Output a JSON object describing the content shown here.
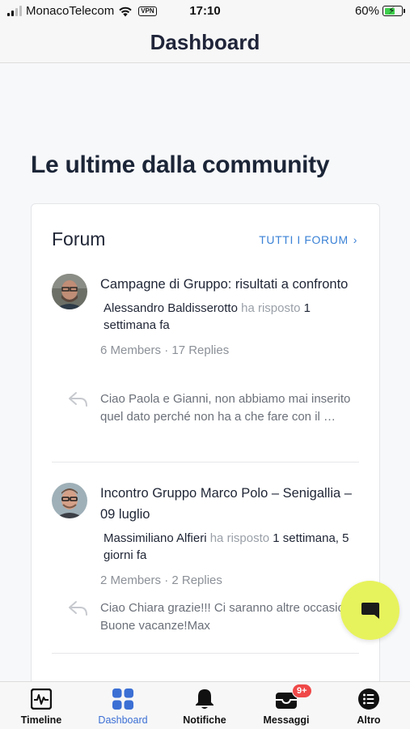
{
  "status_bar": {
    "carrier": "MonacoTelecom",
    "vpn": "VPN",
    "time": "17:10",
    "battery": "60%",
    "battery_level": 0.6
  },
  "header": {
    "title": "Dashboard"
  },
  "section": {
    "title": "Le ultime dalla community"
  },
  "forum_card": {
    "title": "Forum",
    "link_label": "TUTTI I FORUM",
    "topics": [
      {
        "title": "Campagne di Gruppo: risultati a confronto",
        "author": "Alessandro Baldisserotto",
        "action": "ha risposto",
        "time": "1 settimana fa",
        "stats": "6 Members · 17 Replies",
        "reply_excerpt": "Ciao Paola e Gianni, non abbiamo mai inserito quel dato perché non ha a che fare con il …"
      },
      {
        "title": "Incontro Gruppo Marco Polo – Senigallia – 09 luglio",
        "author": "Massimiliano Alfieri",
        "action": "ha risposto",
        "time": "1 settimana, 5 giorni fa",
        "stats": "2 Members · 2 Replies",
        "reply_excerpt": "Ciao Chiara grazie!!! Ci saranno altre occasioni! Buone vacanze!Max"
      }
    ]
  },
  "tabs": [
    {
      "label": "Timeline",
      "icon": "activity-icon"
    },
    {
      "label": "Dashboard",
      "icon": "grid-icon"
    },
    {
      "label": "Notifiche",
      "icon": "bell-icon"
    },
    {
      "label": "Messaggi",
      "icon": "inbox-icon",
      "badge": "9+"
    },
    {
      "label": "Altro",
      "icon": "list-icon"
    }
  ],
  "colors": {
    "accent": "#3b6fd4",
    "link": "#3b82d6",
    "fab": "#e7f35c",
    "badge": "#f04848"
  }
}
